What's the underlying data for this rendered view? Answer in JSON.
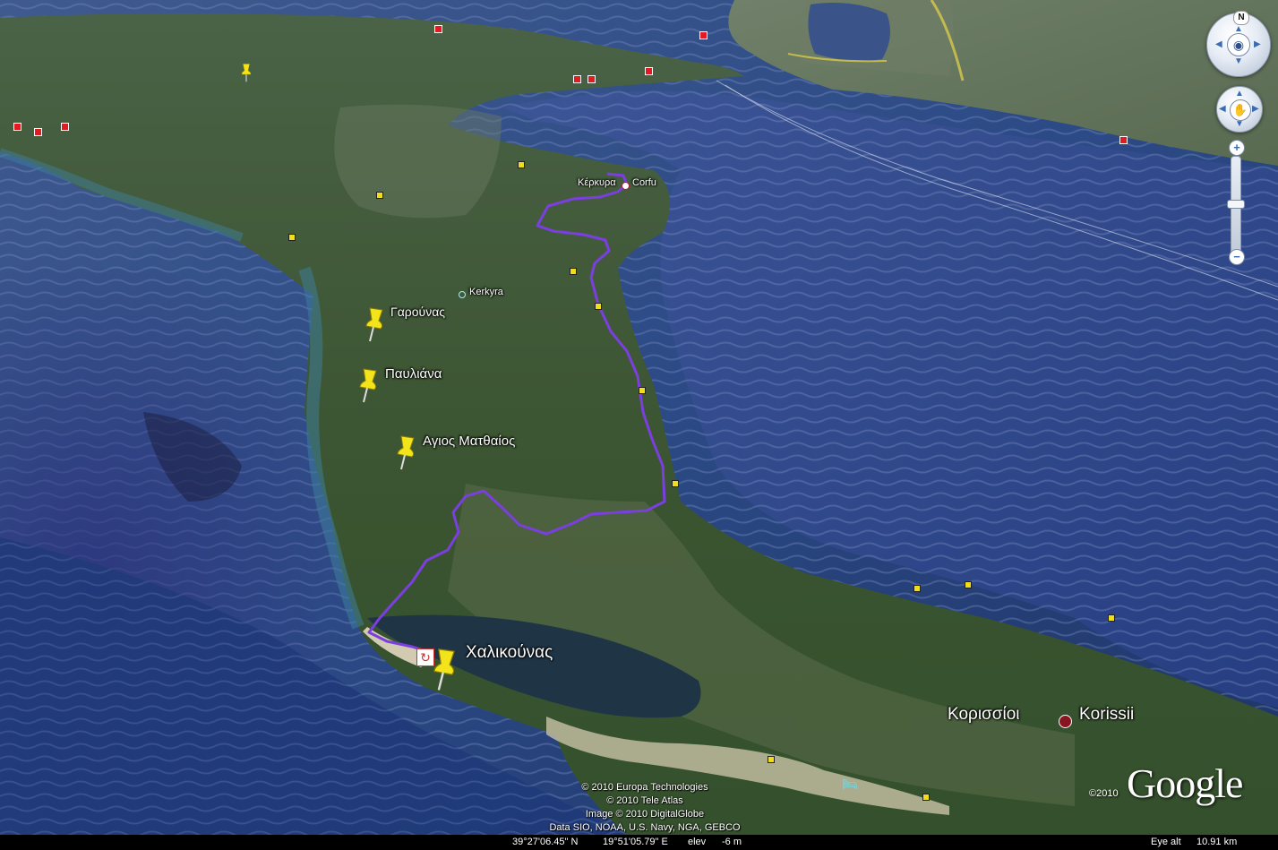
{
  "map": {
    "places": [
      {
        "id": "kerkyra-city-gr",
        "label": "Κέρκυρα"
      },
      {
        "id": "corfu",
        "label": "Corfu"
      },
      {
        "id": "kerkyra",
        "label": "Kerkyra"
      },
      {
        "id": "garounas",
        "label": "Γαρούνας"
      },
      {
        "id": "pavliana",
        "label": "Παυλιάνα"
      },
      {
        "id": "agios-matthaios",
        "label": "Αγιος Ματθαίος"
      },
      {
        "id": "chalikounas",
        "label": "Χαλικούνας"
      },
      {
        "id": "korissioi",
        "label": "Κορισσίοι"
      },
      {
        "id": "korissii",
        "label": "Korissii"
      }
    ],
    "route_color": "#7b3fe0",
    "placemark_color": "#f2e31a"
  },
  "navigation": {
    "north_label": "N",
    "compass_icon": "eye-icon",
    "pan_icon": "hand-icon",
    "zoom_in_label": "+",
    "zoom_out_label": "−"
  },
  "attribution": {
    "lines": [
      "© 2010 Europa Technologies",
      "© 2010 Tele Atlas",
      "Image © 2010 DigitalGlobe",
      "Data SIO, NOAA, U.S. Navy, NGA, GEBCO"
    ],
    "logo_year": "©2010",
    "logo_text": "Google"
  },
  "status": {
    "latitude": "39°27'06.45\" N",
    "longitude": "19°51'05.79\" E",
    "elev_label": "elev",
    "elev_value": "-6 m",
    "eye_alt_label": "Eye alt",
    "eye_alt_value": "10.91 km"
  }
}
